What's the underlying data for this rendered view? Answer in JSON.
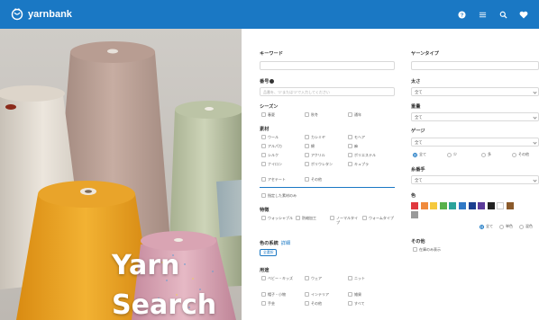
{
  "header": {
    "brand": "yarnbank",
    "icons": [
      "help-icon",
      "list-icon",
      "search-icon",
      "heart-icon"
    ],
    "bar_color": "#1a78c4"
  },
  "hero": {
    "title_line1": "Yarn",
    "title_line2": "Search"
  },
  "form": {
    "keyword": {
      "label": "キーワード",
      "placeholder": ""
    },
    "number": {
      "label": "番号",
      "placeholder": "品番を、\"2\"または\"2\"で入力してください"
    },
    "season": {
      "label": "シーズン",
      "options": [
        "春夏",
        "秋冬",
        "通年"
      ]
    },
    "material": {
      "label": "素材",
      "options": [
        "ウール",
        "カシミヤ",
        "モヘア",
        "アルパカ",
        "綿",
        "麻",
        "シルク",
        "アクリル",
        "ポリエステル",
        "ナイロン",
        "ポリウレタン",
        "キュプラ",
        "アセテート",
        "その他"
      ],
      "extra": "指定した素材のみ"
    },
    "feature": {
      "label": "特徴",
      "options": [
        "ウォッシャブル",
        "防縮加工",
        "ノーマルタイプ",
        "ウォームタイプ"
      ]
    },
    "color_tone": {
      "label": "色の系統",
      "link": "詳細",
      "chip": "全選択"
    },
    "use": {
      "label": "用途",
      "options": [
        "ベビー・キッズ",
        "ウェア",
        "ニット",
        "帽子・小物",
        "インテリア",
        "雑貨",
        "手芸",
        "その他",
        "すべて"
      ]
    },
    "yarn_type": {
      "label": "ヤーンタイプ",
      "placeholder": ""
    },
    "thickness": {
      "label": "太さ",
      "value": "全て"
    },
    "weight": {
      "label": "重量",
      "value": "全て"
    },
    "gauge": {
      "label": "ゲージ",
      "value": "全て",
      "radios": [
        "全て",
        "少",
        "多",
        "その他"
      ]
    },
    "yarn_count": {
      "label": "糸番手",
      "value": "全て"
    },
    "color": {
      "label": "色",
      "swatches": [
        "#e0383e",
        "#f08a3c",
        "#f5c93d",
        "#58b14b",
        "#2aa39b",
        "#2f78c6",
        "#1b3f8f",
        "#5b3a99",
        "#222222",
        "#ffffff",
        "#8b5a2b",
        "#9a9a9a"
      ],
      "radios": [
        "全て",
        "単色",
        "混色"
      ]
    },
    "other": {
      "label": "その他",
      "options": [
        "在庫のみ表示"
      ]
    }
  }
}
